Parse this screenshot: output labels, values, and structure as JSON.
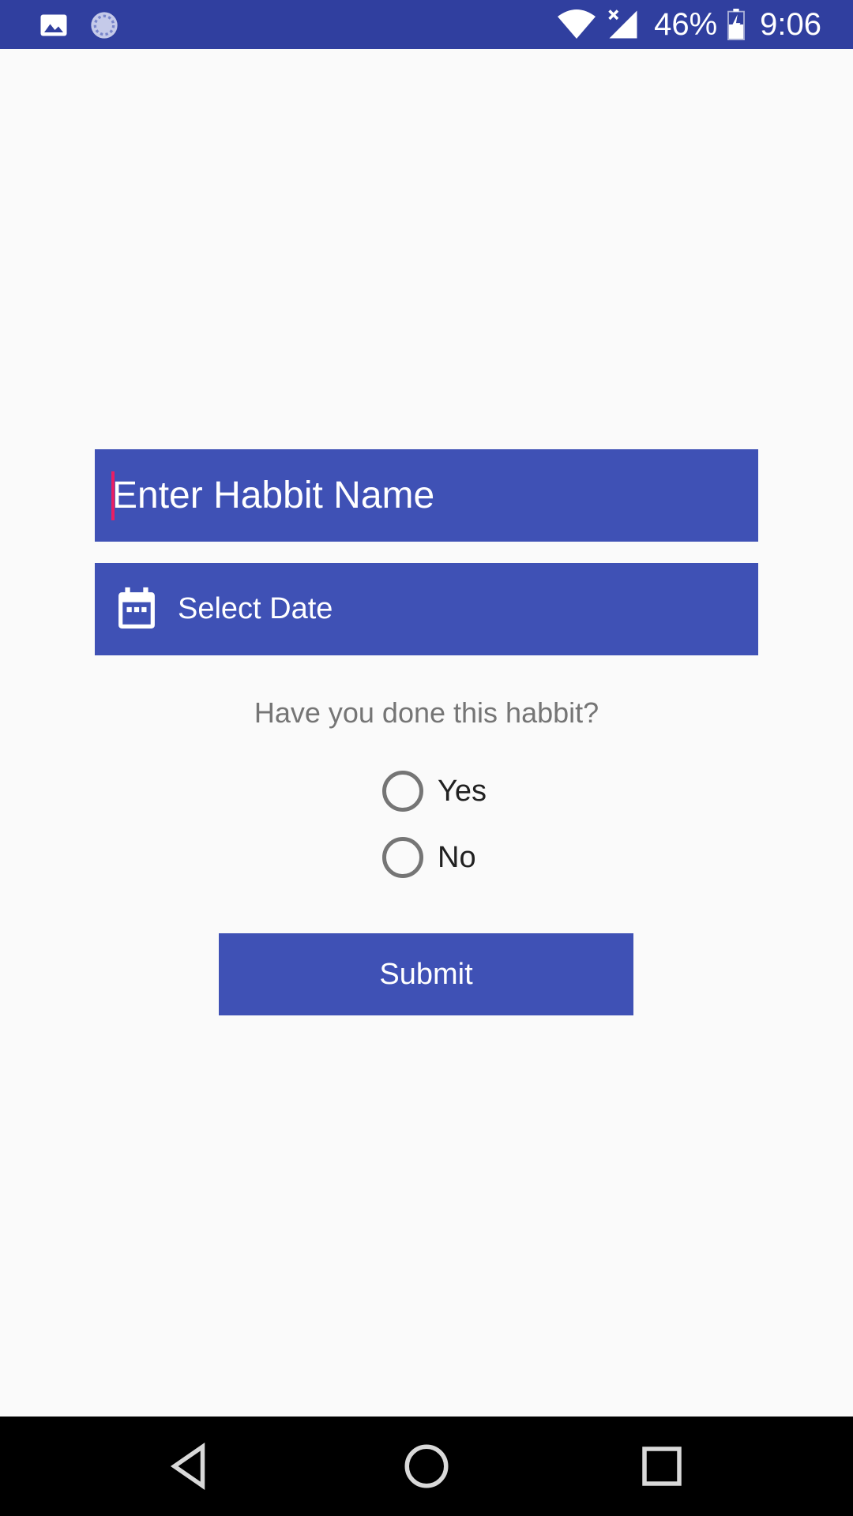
{
  "status_bar": {
    "battery_percent": "46%",
    "time": "9:06",
    "background_color": "#303f9f",
    "icons": [
      "image-icon",
      "sync-icon",
      "wifi-icon",
      "cell-signal-icon",
      "battery-icon"
    ]
  },
  "form": {
    "name_placeholder": "Enter Habbit Name",
    "date_label": "Select Date",
    "question": "Have you done this habbit?",
    "options": [
      {
        "label": "Yes",
        "checked": false
      },
      {
        "label": "No",
        "checked": false
      }
    ],
    "submit_label": "Submit",
    "accent_color": "#3f51b5",
    "cursor_color": "#e91e63"
  },
  "nav_bar": {
    "buttons": [
      "back-icon",
      "home-icon",
      "recents-icon"
    ]
  }
}
